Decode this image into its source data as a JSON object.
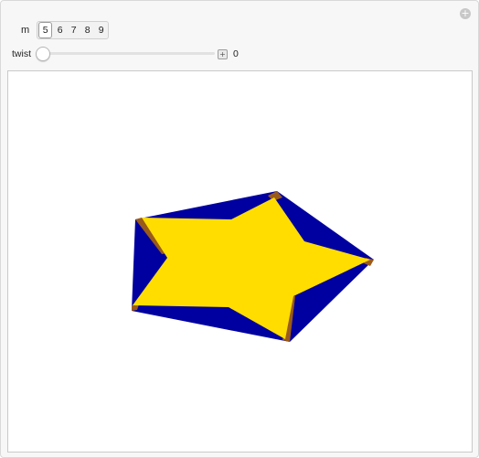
{
  "controls": {
    "m_label": "m",
    "m_options": [
      "5",
      "6",
      "7",
      "8",
      "9"
    ],
    "m_selected": "5",
    "twist_label": "twist",
    "twist_value": "0",
    "twist_fraction": 0
  },
  "colors": {
    "star": "#ffdd00",
    "outer": "#0000a0",
    "edge": "#9a5a1a"
  },
  "icons": {
    "corner": "plus-circle-icon",
    "slider_expand": "plus-box-icon"
  }
}
